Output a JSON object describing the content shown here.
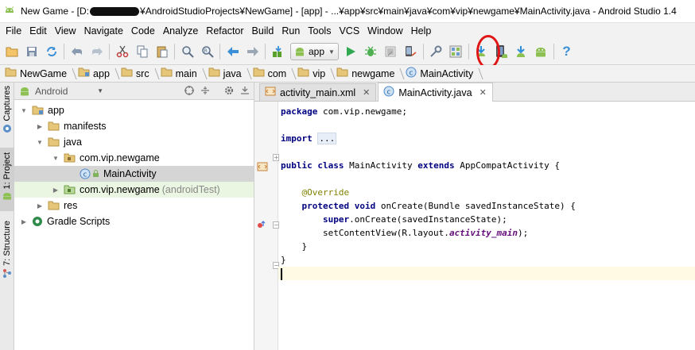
{
  "window": {
    "title_prefix": "New Game - [D:",
    "title_suffix": "¥AndroidStudioProjects¥NewGame] - [app] - ...¥app¥src¥main¥java¥com¥vip¥newgame¥MainActivity.java - Android Studio 1.4"
  },
  "menu": [
    "File",
    "Edit",
    "View",
    "Navigate",
    "Code",
    "Analyze",
    "Refactor",
    "Build",
    "Run",
    "Tools",
    "VCS",
    "Window",
    "Help"
  ],
  "toolbar": {
    "run_config": "app",
    "highlight_color": "#e01515"
  },
  "breadcrumbs": [
    "NewGame",
    "app",
    "src",
    "main",
    "java",
    "com",
    "vip",
    "newgame",
    "MainActivity"
  ],
  "side_tabs": {
    "captures": "Captures",
    "project": "1: Project",
    "structure": "7: Structure"
  },
  "project_panel": {
    "view_mode": "Android",
    "tree": [
      {
        "label": "app",
        "level": 0,
        "expanded": true,
        "icon": "module-icon"
      },
      {
        "label": "manifests",
        "level": 1,
        "expanded": false,
        "icon": "folder-icon"
      },
      {
        "label": "java",
        "level": 1,
        "expanded": true,
        "icon": "folder-icon"
      },
      {
        "label": "com.vip.newgame",
        "level": 2,
        "expanded": true,
        "icon": "package-icon"
      },
      {
        "label": "MainActivity",
        "level": 3,
        "icon": "class-icon",
        "selected": true
      },
      {
        "label": "com.vip.newgame",
        "suffix": "(androidTest)",
        "level": 2,
        "expanded": false,
        "icon": "package-icon",
        "green": true
      },
      {
        "label": "res",
        "level": 1,
        "expanded": false,
        "icon": "folder-icon"
      },
      {
        "label": "Gradle Scripts",
        "level": 0,
        "expanded": false,
        "icon": "gradle-icon"
      }
    ]
  },
  "editor": {
    "tabs": [
      {
        "label": "activity_main.xml",
        "active": false
      },
      {
        "label": "MainActivity.java",
        "active": true
      }
    ],
    "code": {
      "package_kw": "package",
      "package_name": " com.vip.newgame;",
      "import_kw": "import",
      "import_fold": "...",
      "class_kw1": "public",
      "class_kw2": "class",
      "class_name": " MainActivity ",
      "extends_kw": "extends",
      "super_class": " AppCompatActivity {",
      "annotation": "@Override",
      "method_kw1": "protected",
      "method_kw2": "void",
      "method_sig": " onCreate(Bundle savedInstanceState) {",
      "super_kw": "super",
      "super_call": ".onCreate(savedInstanceState);",
      "setcontent": "setContentView(R.layout.",
      "layout_field": "activity_main",
      "setcontent_end": ");",
      "close_method": "}",
      "close_class": "}"
    }
  }
}
